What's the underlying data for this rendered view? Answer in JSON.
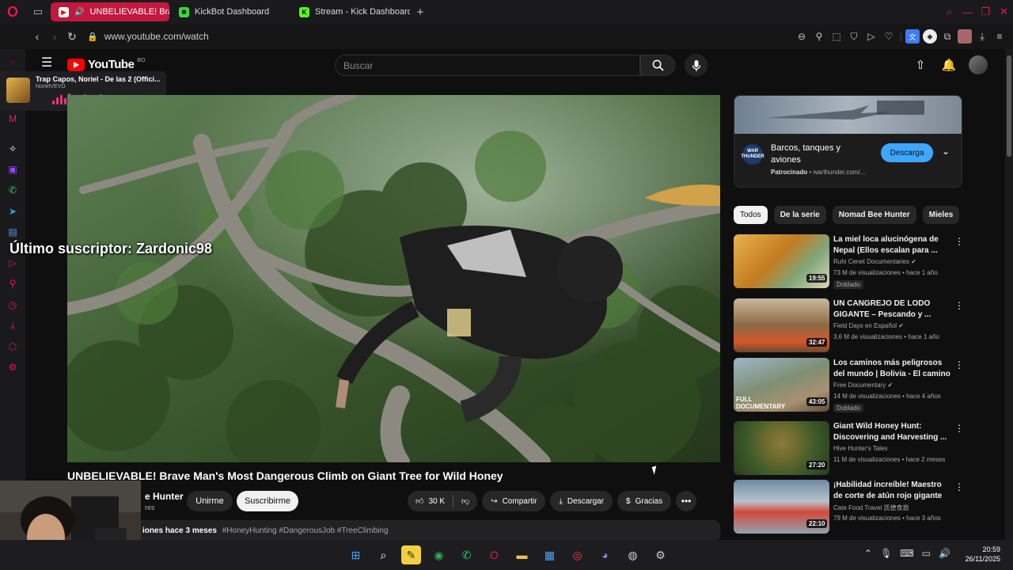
{
  "browser": {
    "tabs": [
      {
        "label": "UNBELIEVABLE! Brave Man's Most Dangerous Climb on Giant Tree for Wild Honey",
        "active": true
      },
      {
        "label": "KickBot Dashboard",
        "active": false
      },
      {
        "label": "Stream - Kick Dashboard",
        "active": false
      }
    ],
    "url": "www.youtube.com/watch"
  },
  "mini_player": {
    "title": "Trap Capos, Noriel - De las 2 (Offici...",
    "artist": "NorielVEVO"
  },
  "youtube": {
    "logo_text": "YouTube",
    "country_code": "BO",
    "search_placeholder": "Buscar"
  },
  "stream_overlay": {
    "text": "Último suscriptor: Zardonic98"
  },
  "video": {
    "title": "UNBELIEVABLE! Brave Man's Most Dangerous Climb on Giant Tree for Wild Honey",
    "channel_name": "e Hunter",
    "channel_subs": "res",
    "join_label": "Unirme",
    "subscribe_label": "Suscribirme",
    "likes": "30 K",
    "share_label": "Compartir",
    "download_label": "Descargar",
    "thanks_label": "Gracias",
    "description_views": "iones",
    "description_date": "hace 3 meses",
    "description_tags": "#HoneyHunting #DangerousJob #TreeClimbing"
  },
  "ad": {
    "title": "Barcos, tanques y aviones",
    "sponsored_label": "Patrocinado",
    "sponsor_domain": "• warthunder.com/...",
    "button_label": "Descarga",
    "logo_text": "WAR THUNDER"
  },
  "chips": [
    {
      "label": "Todos",
      "active": true
    },
    {
      "label": "De la serie",
      "active": false
    },
    {
      "label": "Nomad Bee Hunter",
      "active": false
    },
    {
      "label": "Mieles",
      "active": false
    }
  ],
  "recommendations": [
    {
      "title": "La miel loca alucinógena de Nepal (Ellos escalan para ...",
      "channel": "Ruhi Cenet Documentaries ✔",
      "meta": "73 M de visualizaciones • hace 1 año",
      "duration": "19:55",
      "badge": "Doblado"
    },
    {
      "title": "UN CANGREJO DE LODO GIGANTE – Pescando y ...",
      "channel": "Field Days en Español ✔",
      "meta": "3,6 M de visualizaciones • hace 1 año",
      "duration": "32:47",
      "badge": ""
    },
    {
      "title": "Los caminos más peligrosos del mundo | Bolivia - El camino de ...",
      "channel": "Free Documentary ✔",
      "meta": "14 M de visualizaciones • hace 4 años",
      "duration": "43:05",
      "badge": "Doblado"
    },
    {
      "title": "Giant Wild Honey Hunt: Discovering and Harvesting ...",
      "channel": "Hive Hunter's Tales",
      "meta": "11 M de visualizaciones • hace 2 meses",
      "duration": "27:20",
      "badge": ""
    },
    {
      "title": "¡Habilidad increíble! Maestro de corte de atún rojo gigante de ...",
      "channel": "Cate Food Travel 凯德食旅",
      "meta": "79 M de visualizaciones • hace 3 años",
      "duration": "22:10",
      "badge": ""
    }
  ],
  "rec3_overlay": "FULL DOCUMENTARY",
  "taskbar": {
    "time": "20:59",
    "date": "26/11/2025"
  }
}
